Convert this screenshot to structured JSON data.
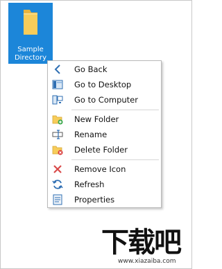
{
  "desktop": {
    "folder_label_line1": "Sample",
    "folder_label_line2": "Directory"
  },
  "context_menu": {
    "items": [
      {
        "label": "Go Back",
        "icon": "back-arrow-icon"
      },
      {
        "label": "Go to Desktop",
        "icon": "desktop-icon"
      },
      {
        "label": "Go to Computer",
        "icon": "computer-icon"
      },
      {
        "label": "New Folder",
        "icon": "new-folder-icon"
      },
      {
        "label": "Rename",
        "icon": "rename-icon"
      },
      {
        "label": "Delete Folder",
        "icon": "delete-folder-icon"
      },
      {
        "label": "Remove Icon",
        "icon": "remove-x-icon"
      },
      {
        "label": "Refresh",
        "icon": "refresh-icon"
      },
      {
        "label": "Properties",
        "icon": "properties-icon"
      }
    ]
  },
  "watermark": {
    "text": "下载吧",
    "url": "www.xiazaiba.com"
  },
  "colors": {
    "selection": "#1c86d9",
    "folder": "#f7cc5a",
    "delete_red": "#d93a3a",
    "accent_blue": "#2f6fb3"
  }
}
